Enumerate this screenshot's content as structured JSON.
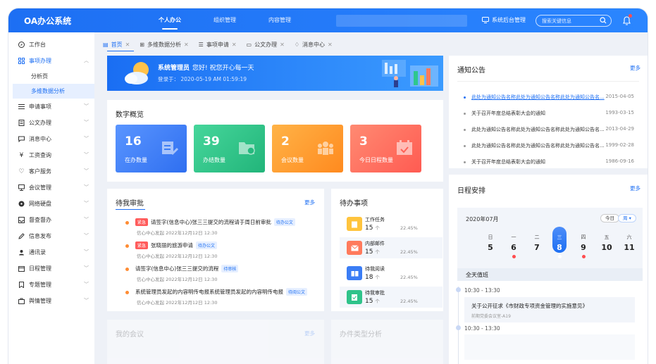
{
  "app": {
    "title": "OA办公系统"
  },
  "top_nav": [
    {
      "label": "个人办公",
      "active": true
    },
    {
      "label": "组织管理"
    },
    {
      "label": "内容管理"
    }
  ],
  "admin_label": "系统后台管理",
  "search_placeholder": "搜索关键信息",
  "sidebar": {
    "items": [
      {
        "label": "工作台",
        "icon": "compass-icon"
      },
      {
        "label": "事项办理",
        "icon": "grid-icon",
        "expanded": true
      },
      {
        "label": "申请事项",
        "icon": "list-icon"
      },
      {
        "label": "公文办理",
        "icon": "document-icon"
      },
      {
        "label": "消息中心",
        "icon": "chat-icon"
      },
      {
        "label": "工资查询",
        "icon": "yen-icon"
      },
      {
        "label": "客户服务",
        "icon": "heart-icon"
      },
      {
        "label": "会议管理",
        "icon": "monitor-icon"
      },
      {
        "label": "网络硬盘",
        "icon": "disk-icon"
      },
      {
        "label": "督查督办",
        "icon": "inbox-icon"
      },
      {
        "label": "信息发布",
        "icon": "pencil-icon"
      },
      {
        "label": "通讯录",
        "icon": "contacts-icon"
      },
      {
        "label": "日程管理",
        "icon": "calendar-icon"
      },
      {
        "label": "专题管理",
        "icon": "bookmark-icon"
      },
      {
        "label": "舆情管理",
        "icon": "bag-icon"
      }
    ],
    "sub_items": [
      {
        "label": "分析页"
      },
      {
        "label": "多维数据分析",
        "active": true
      }
    ]
  },
  "tabs": [
    {
      "label": "首页",
      "active": true
    },
    {
      "label": "多维数据分析"
    },
    {
      "label": "事项申请"
    },
    {
      "label": "公文办理"
    },
    {
      "label": "消息中心"
    }
  ],
  "banner": {
    "name": "系统管理员",
    "greeting": "您好! 祝您开心每一天",
    "login": "登录于：  2020-05-19   AM 01:59:19"
  },
  "overview": {
    "title": "数字概览",
    "stats": [
      {
        "value": "16",
        "label": "在办数量",
        "color": "#3b7df5"
      },
      {
        "value": "39",
        "label": "办结数量",
        "color": "#2fc38a"
      },
      {
        "value": "2",
        "label": "会议数量",
        "color": "#ff9a2b"
      },
      {
        "value": "3",
        "label": "今日日程数量",
        "color": "#ff6b5b"
      }
    ]
  },
  "approvals": {
    "title": "待我审批",
    "more": "更多",
    "items": [
      {
        "urgent": "紧急",
        "title": "请签字(信息中心)张三三提交的流程请于周日前审批",
        "tag": "待办公文",
        "meta": "信心中心发起    2022年12月12日 12:30"
      },
      {
        "urgent": "紧急",
        "title": "张晓丽的旅游申请",
        "tag": "待办公文",
        "meta": "信心中心发起    2022年12月12日 12:30"
      },
      {
        "urgent": "",
        "title": "请签字(信息中心)张三三提交的流程",
        "tag": "待审核",
        "meta": "信心中心发起    2022年12月12日 12:30"
      },
      {
        "urgent": "",
        "title": "系统管理员发起的内容明传电报系统管理员发起的内容明传电报",
        "tag": "待阅公文",
        "meta": "信心中心发起    2022年12月12日 12:30"
      }
    ]
  },
  "todos": {
    "title": "待办事项",
    "items": [
      {
        "name": "工作任务",
        "count": "15",
        "unit": "个",
        "pct": "22.45%",
        "color": "#ffc43d",
        "icon": "clipboard-icon"
      },
      {
        "name": "内部邮件",
        "count": "15",
        "unit": "个",
        "pct": "22.45%",
        "color": "#ff7a5c",
        "icon": "mail-icon"
      },
      {
        "name": "待我阅读",
        "count": "18",
        "unit": "个",
        "pct": "22.45%",
        "color": "#3b7df5",
        "icon": "book-icon"
      },
      {
        "name": "待我审批",
        "count": "15",
        "unit": "个",
        "pct": "22.45%",
        "color": "#2fc38a",
        "icon": "approve-icon"
      }
    ]
  },
  "notices": {
    "title": "通知公告",
    "more": "更多",
    "items": [
      {
        "text": "此处为通知公告名称此处为通知公告名称此处为通知公告名...",
        "date": "2015-04-05"
      },
      {
        "text": "关于召开年度总结表彰大会的通知",
        "date": "1993-03-15"
      },
      {
        "text": "此处为通知公告名称此处为通知公告名称此处为通知公告名...",
        "date": "2013-04-29"
      },
      {
        "text": "此处为通知公告名称此处为通知公告名称此处为通知公告名...",
        "date": "1999-02-28"
      },
      {
        "text": "关于召开年度总结表彰大会的通知",
        "date": "1986-09-16"
      }
    ]
  },
  "schedule": {
    "title": "日程安排",
    "more": "更多",
    "month": "2020年07月",
    "today_btn": "今日",
    "view_btn": "周",
    "weekdays": [
      "日",
      "一",
      "二",
      "三",
      "四",
      "五",
      "六"
    ],
    "days": [
      "5",
      "6",
      "7",
      "8",
      "9",
      "10",
      "11"
    ],
    "allday": "全天值班",
    "events": [
      {
        "time": "10:30 - 13:30",
        "title": "关于公开征求《市财政专项资金管理的实施意见》",
        "sub": "前期党委会议室-A19"
      },
      {
        "time": "10:30 - 13:30"
      }
    ]
  },
  "faded": {
    "meeting": "我的会议",
    "meeting_more": "更多",
    "types": "办件类型分析"
  }
}
